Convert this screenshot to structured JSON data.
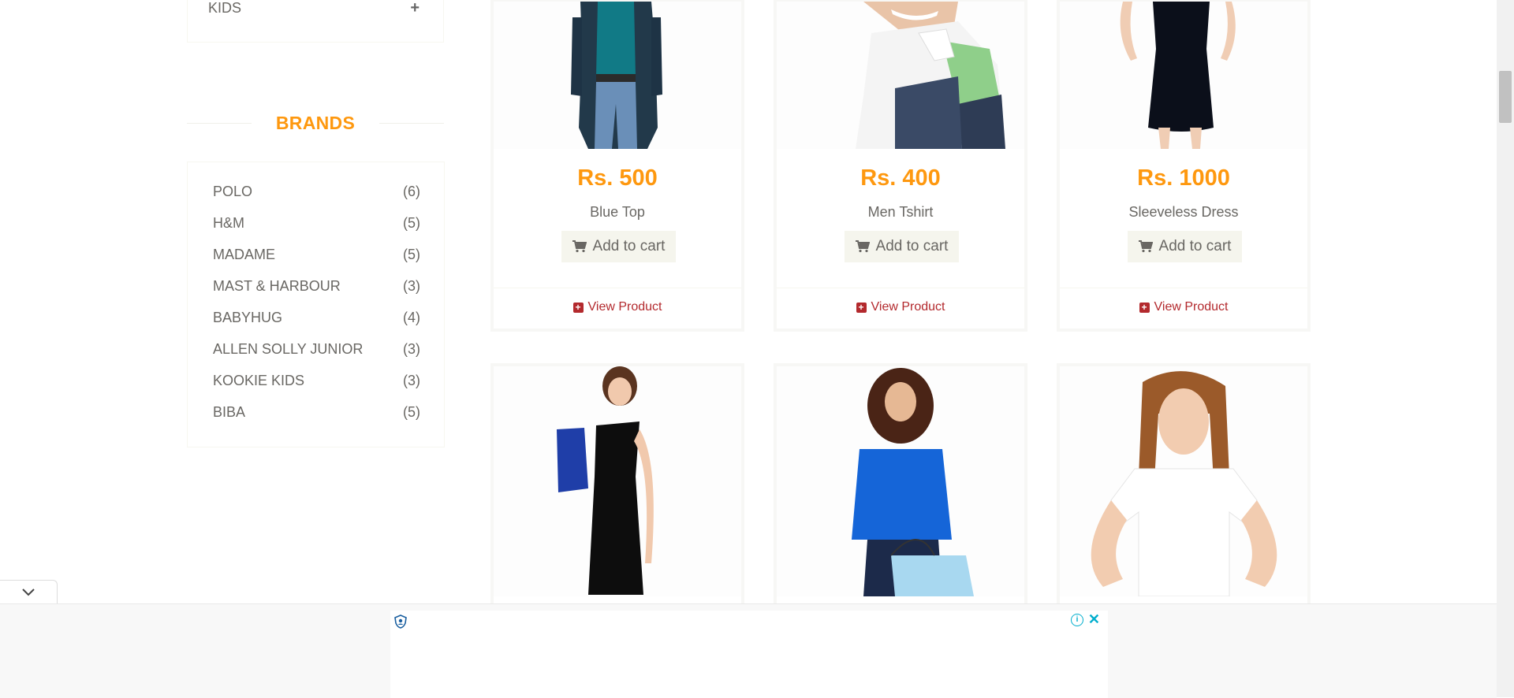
{
  "sidebar": {
    "category": {
      "label": "KIDS",
      "toggle": "+"
    },
    "brands_title": "BRANDS",
    "brands": [
      {
        "name": "POLO",
        "count": "(6)"
      },
      {
        "name": "H&M",
        "count": "(5)"
      },
      {
        "name": "MADAME",
        "count": "(5)"
      },
      {
        "name": "MAST & HARBOUR",
        "count": "(3)"
      },
      {
        "name": "BABYHUG",
        "count": "(4)"
      },
      {
        "name": "ALLEN SOLLY JUNIOR",
        "count": "(3)"
      },
      {
        "name": "KOOKIE KIDS",
        "count": "(3)"
      },
      {
        "name": "BIBA",
        "count": "(5)"
      }
    ]
  },
  "products": [
    {
      "price": "Rs. 500",
      "name": "Blue Top",
      "cart_label": "Add to cart",
      "view_label": "View Product"
    },
    {
      "price": "Rs. 400",
      "name": "Men Tshirt",
      "cart_label": "Add to cart",
      "view_label": "View Product"
    },
    {
      "price": "Rs. 1000",
      "name": "Sleeveless Dress",
      "cart_label": "Add to cart",
      "view_label": "View Product"
    }
  ],
  "ad": {
    "info_icon": "i",
    "close_icon": "✕",
    "collapse_icon": "chevron-down-icon"
  },
  "colors": {
    "accent": "#FE980F",
    "link": "#B3292D",
    "button_bg": "#F5F5ED"
  }
}
